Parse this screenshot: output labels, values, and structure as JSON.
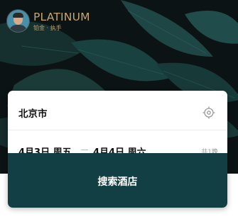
{
  "member": {
    "level": "PLATINUM",
    "subtitle": "铂金 · 执手"
  },
  "search": {
    "city": "北京市",
    "check_in": "4月3日 周五",
    "check_out": "4月4日 周六",
    "nights": "共1晚",
    "button_label": "搜索酒店"
  },
  "colors": {
    "gold": "#c9a56b",
    "button": "#123f43",
    "hero_background": "#0c1314"
  },
  "icons": {
    "locate": "locate-icon"
  }
}
